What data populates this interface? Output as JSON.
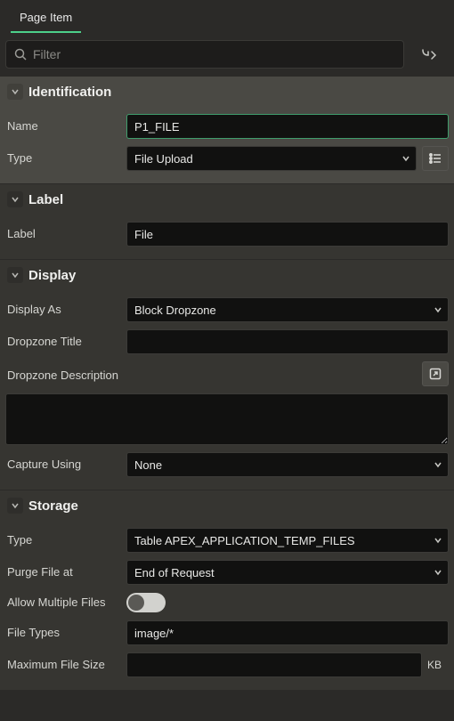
{
  "tab": {
    "label": "Page Item"
  },
  "filter": {
    "placeholder": "Filter"
  },
  "identification": {
    "title": "Identification",
    "name_label": "Name",
    "name_value": "P1_FILE",
    "type_label": "Type",
    "type_value": "File Upload"
  },
  "labelsec": {
    "title": "Label",
    "label_label": "Label",
    "label_value": "File"
  },
  "display": {
    "title": "Display",
    "display_as_label": "Display As",
    "display_as_value": "Block Dropzone",
    "dz_title_label": "Dropzone Title",
    "dz_title_value": "",
    "dz_desc_label": "Dropzone Description",
    "dz_desc_value": "",
    "capture_label": "Capture Using",
    "capture_value": "None"
  },
  "storage": {
    "title": "Storage",
    "type_label": "Type",
    "type_value": "Table APEX_APPLICATION_TEMP_FILES",
    "purge_label": "Purge File at",
    "purge_value": "End of Request",
    "multi_label": "Allow Multiple Files",
    "types_label": "File Types",
    "types_value": "image/*",
    "max_label": "Maximum File Size",
    "max_value": "",
    "max_unit": "KB"
  }
}
